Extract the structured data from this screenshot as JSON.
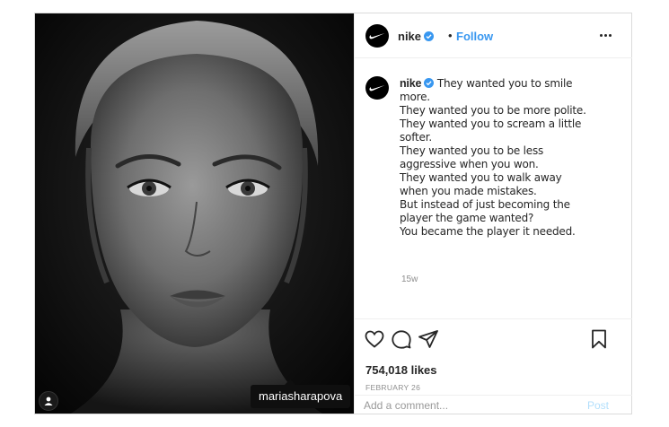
{
  "header": {
    "username": "nike",
    "separator": "•",
    "follow_label": "Follow"
  },
  "photo": {
    "tag_username": "mariasharapova"
  },
  "caption": {
    "username": "nike",
    "text": " They wanted you to smile more.\nThey wanted you to be more polite.\nThey wanted you to scream a little softer.\nThey wanted you to be less aggressive when you won.\nThey wanted you to walk away when you made mistakes.\nBut instead of just becoming the player the game wanted?\nYou became the player it needed.",
    "age": "15w"
  },
  "actions": {
    "likes": "754,018 likes",
    "date": "FEBRUARY 26"
  },
  "comment": {
    "placeholder": "Add a comment...",
    "post_label": "Post"
  },
  "colors": {
    "accent": "#3897f0",
    "post_disabled": "#b2dffc",
    "muted": "#8e8e8e",
    "border": "#dbdbdb"
  },
  "icons": [
    "user-tag-icon",
    "nike-swoosh-icon",
    "verified-badge-icon",
    "more-options-icon",
    "heart-icon",
    "comment-icon",
    "share-icon",
    "bookmark-icon"
  ]
}
